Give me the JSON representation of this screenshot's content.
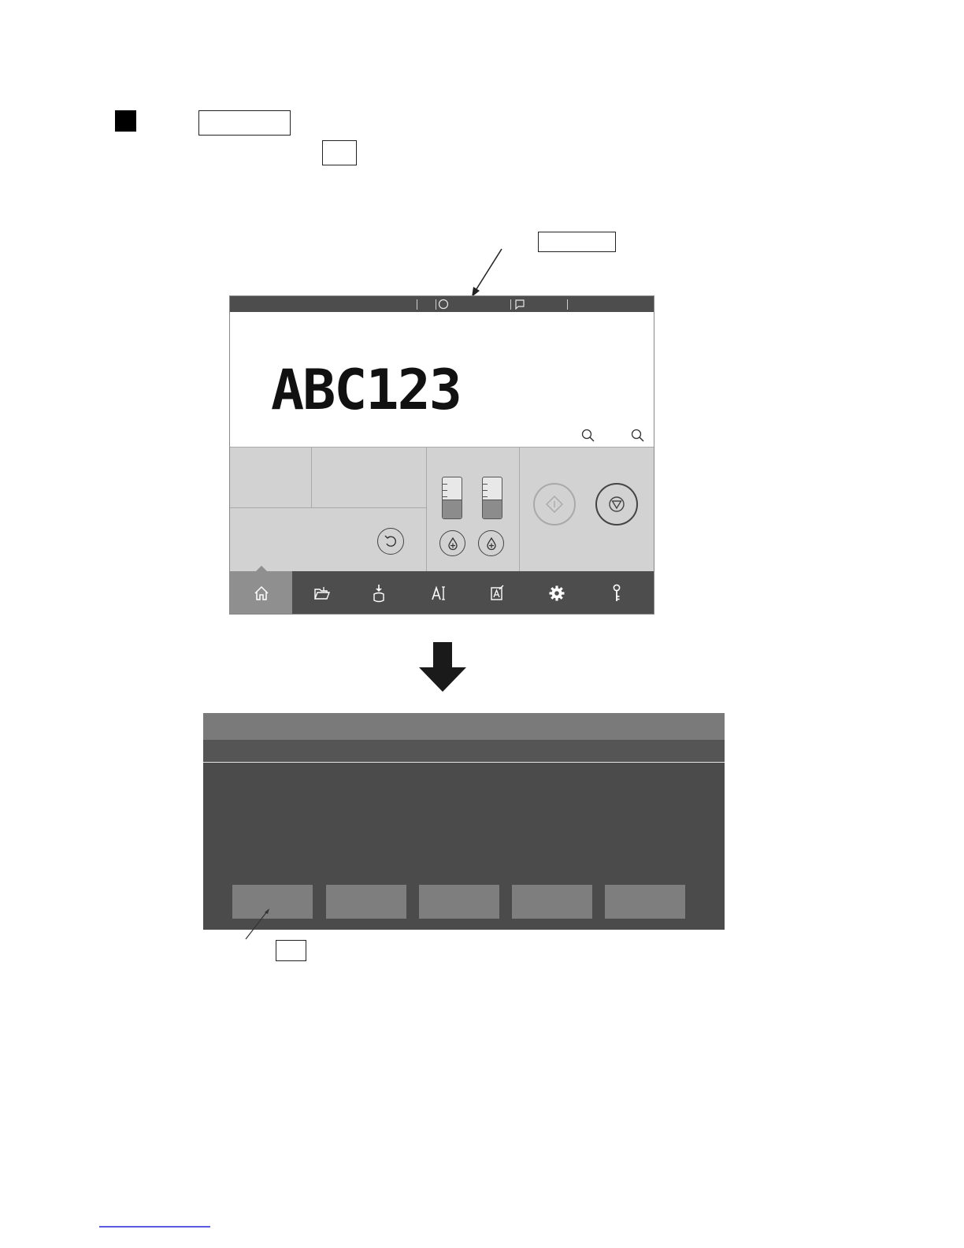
{
  "header": {
    "bullet_icon": "filled-square-icon",
    "label_a": "",
    "label_b": ""
  },
  "callouts": {
    "status_bar_label": "",
    "button_label": ""
  },
  "screen1": {
    "preview_text": "ABC123",
    "ink_levels": [
      0.45,
      0.45
    ],
    "nav": {
      "items": [
        "home-icon",
        "folder-open-icon",
        "download-bottle-icon",
        "edit-text-icon",
        "edit-message-icon",
        "gear-icon",
        "key-icon"
      ],
      "active": "home-icon"
    }
  },
  "screen2": {
    "button_count": 5
  },
  "colors": {
    "status_bar": "#4d4d4d",
    "panel": "#d2d2d2",
    "nav_active": "#8f8f8f",
    "dialog_bg": "#4c4b4c",
    "dialog_title": "#7b7a7b",
    "dialog_button": "#7f7e7f"
  }
}
